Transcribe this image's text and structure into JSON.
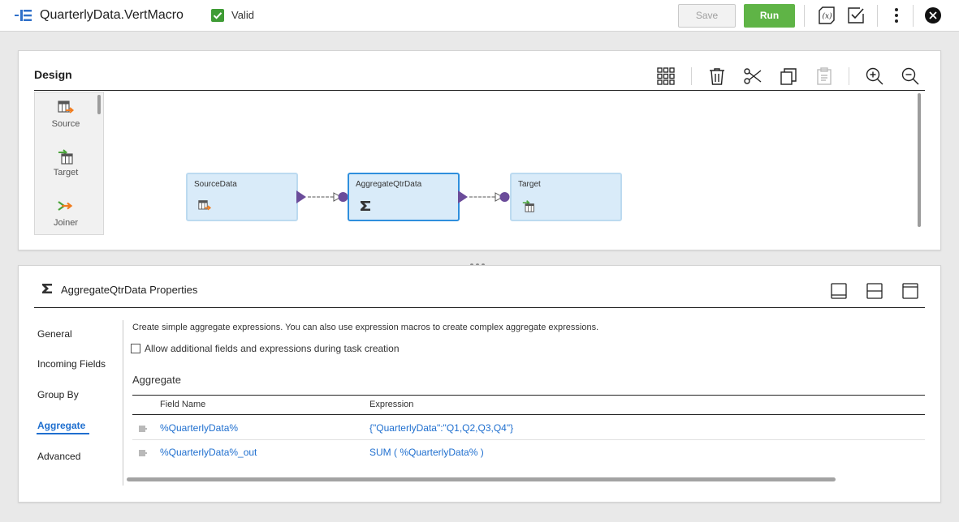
{
  "header": {
    "title": "QuarterlyData.VertMacro",
    "status": "Valid",
    "save_label": "Save",
    "run_label": "Run",
    "icons": [
      "mapping-icon",
      "parameters-icon",
      "validate-icon",
      "more-icon",
      "close-icon"
    ]
  },
  "design": {
    "title": "Design",
    "toolbar_icons": [
      "arrange-all-icon",
      "delete-icon",
      "cut-icon",
      "copy-icon",
      "paste-icon",
      "zoom-in-icon",
      "zoom-out-icon"
    ],
    "palette": [
      {
        "label": "Source",
        "icon": "source-icon"
      },
      {
        "label": "Target",
        "icon": "target-icon"
      },
      {
        "label": "Joiner",
        "icon": "joiner-icon"
      }
    ],
    "nodes": [
      {
        "title": "SourceData",
        "icon": "source-icon"
      },
      {
        "title": "AggregateQtrData",
        "icon": "sigma-icon"
      },
      {
        "title": "Target",
        "icon": "target-icon"
      }
    ]
  },
  "properties": {
    "title": "AggregateQtrData Properties",
    "layout_icons": [
      "dock-bottom-icon",
      "split-horizontal-icon",
      "maximize-panel-icon"
    ],
    "nav": [
      {
        "label": "General"
      },
      {
        "label": "Incoming Fields"
      },
      {
        "label": "Group By"
      },
      {
        "label": "Aggregate",
        "active": true
      },
      {
        "label": "Advanced"
      }
    ],
    "description": "Create simple aggregate expressions. You can also use expression macros to create complex aggregate expressions.",
    "allow_label": "Allow additional fields and expressions during task creation",
    "allow_checked": false,
    "section_title": "Aggregate",
    "columns": [
      "Field Name",
      "Expression"
    ],
    "rows": [
      {
        "field": "%QuarterlyData%",
        "expression": "{\"QuarterlyData\":\"Q1,Q2,Q3,Q4\"}"
      },
      {
        "field": "%QuarterlyData%_out",
        "expression": "SUM ( %QuarterlyData% )"
      }
    ]
  },
  "colors": {
    "accent": "#1f6fcf",
    "run": "#5fb446",
    "node_fill": "#d9ebf9",
    "node_selected_border": "#2f8fdd",
    "port": "#6b4c9a"
  }
}
